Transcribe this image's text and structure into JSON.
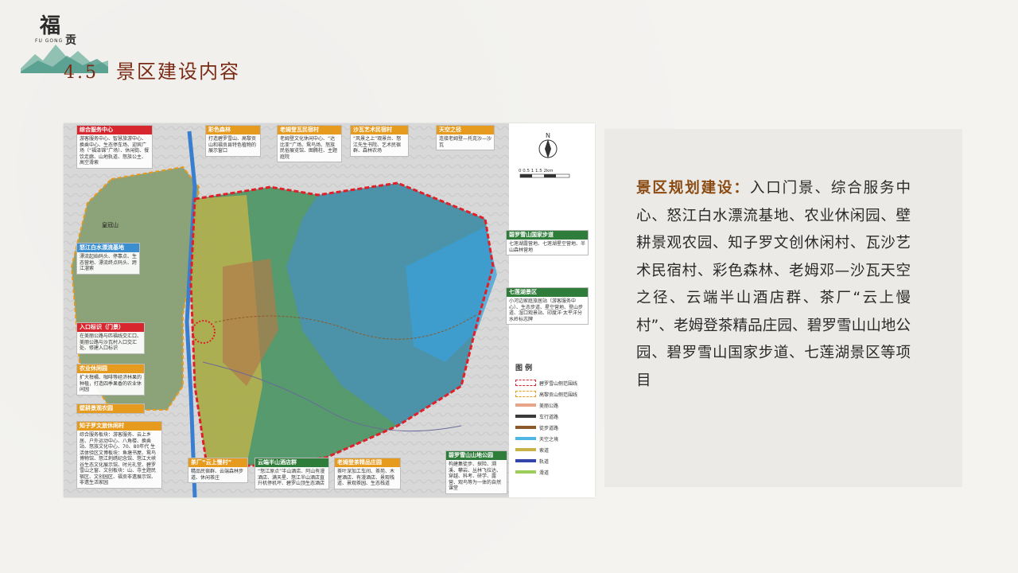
{
  "logo": {
    "char_main": "福",
    "char_small": "贡",
    "subtitle": "FU GONG"
  },
  "heading": {
    "number": "4.5",
    "title": "景区建设内容"
  },
  "description": {
    "label": "景区规划建设：",
    "body": "入口门景、综合服务中心、怒江白水漂流基地、农业休闲园、壁耕景观农园、知子罗文创休闲村、瓦沙艺术民宿村、彩色森林、老姆邓—沙瓦天空之径、云端半山酒店群、茶厂“云上慢村”、老姆登茶精品庄园、碧罗雪山山地公园、碧罗雪山国家步道、七莲湖景区等项目"
  },
  "map": {
    "scale": "0  0.5  1   1.5  2km",
    "north": "N",
    "place_label": "皇冠山",
    "callouts": [
      {
        "title": "综合服务中心",
        "body": "游客服务中心、智慧旅游中心、换乘中心、生态停车场、迎宾广场（“福泽锦”广场）、休闲街、餐饮走廊、山地轨道、怒族公主、高空滑索",
        "color": "red"
      },
      {
        "title": "彩色森林",
        "body": "打造碧罗雪山、高黎贡山和福贡县特色植物的展示窗口",
        "color": "orange"
      },
      {
        "title": "老姆登瓦民宿村",
        "body": "老姆登文化休闲中心、“达比亚”广场、鸳鸟场、怒族民俗展览馆、图腾柱、主题庭院",
        "color": "orange"
      },
      {
        "title": "沙瓦艺术民宿村",
        "body": "“风景之上”观景台、怒江先生书院、艺术民宿群、森林农场",
        "color": "orange"
      },
      {
        "title": "天空之径",
        "body": "连接老姆登—托克沙—沙瓦",
        "color": "orange"
      },
      {
        "title": "怒江白水漂流基地",
        "body": "漂流起始码头、停靠点、生态营地、漂流终点码头、跨江溜索",
        "color": "blue"
      },
      {
        "title": "碧罗雪山国家步道",
        "body": "七莲湖露营地、七莲湖星空营地、半山森林营地",
        "color": "green"
      },
      {
        "title": "七莲湖景区",
        "body": "小河边家庭旅居站（游客服务中心）、生态步道、星空营地、登山步道、湿口观景站、印度洋·太平洋分水岭标志牌",
        "color": "green"
      },
      {
        "title": "入口标识（门景）",
        "body": "在美丽公路与匹福线交汇口、美丽公路与沙瓦村入口交汇处、修建入口标识",
        "color": "red"
      },
      {
        "title": "农业休闲园",
        "body": "扩大柑橘、咖啡等经济林果的种植，打造四季果香的农业休闲园",
        "color": "orange"
      },
      {
        "title": "壁耕景观农园",
        "body": "",
        "color": "orange"
      },
      {
        "title": "知子罗文旅休闲村",
        "body": "综合服务板块：游客服务、云上乡居、户外运动中心、八角楼、换乘站、怒族文化中心、70、80年代 生活体验区文博板块：鱼塘书屋、鸳鸟博物馆、怒江刺绣纪念馆、怒江大峡谷生态文化展示馆、时光礼堂、碧罗雪山之窗、文创板块：山、寺主题民宿区、文创园区、福贡非遗展示馆、非遗生活家园",
        "color": "orange"
      },
      {
        "title": "茶厂“云上慢村”",
        "body": "精品民宿群、云端森林步道、休闲茶庄",
        "color": "orange"
      },
      {
        "title": "云端半山酒店群",
        "body": "“怒江原点”半山酒店、阿山有漫酒店、满天星、怒江半山酒店直升机停机坪、碧罗山顶生态酒店",
        "color": "green"
      },
      {
        "title": "老姆登茶精品庄园",
        "body": "茶叶深加工车间、茶苑、木屋酒店、有漫酒店、景观栈道、景观茶园、生态栈道",
        "color": "orange"
      },
      {
        "title": "碧罗雪山山地公园",
        "body": "构建集徒步、探险、溯溪、攀岩、丛林飞拉达、穿越、科考、研学、露营、观鸟等为一体的自然课堂",
        "color": "green"
      }
    ],
    "legend": {
      "title": "图  例",
      "items": [
        {
          "label": "碧罗雪山侧范围线",
          "color": "#d7262d",
          "kind": "dash"
        },
        {
          "label": "高黎贡山侧范围线",
          "color": "#e89a1f",
          "kind": "dash"
        },
        {
          "label": "美丽公路",
          "color": "#e9a58a",
          "kind": "line"
        },
        {
          "label": "车行道路",
          "color": "#3a3a3a",
          "kind": "line"
        },
        {
          "label": "徒步道路",
          "color": "#8b5a2b",
          "kind": "line"
        },
        {
          "label": "天空之境",
          "color": "#4db6e5",
          "kind": "line"
        },
        {
          "label": "索道",
          "color": "#c8b24a",
          "kind": "line"
        },
        {
          "label": "轨道",
          "color": "#3344aa",
          "kind": "line"
        },
        {
          "label": "滑道",
          "color": "#9ccf5a",
          "kind": "line"
        }
      ]
    }
  }
}
